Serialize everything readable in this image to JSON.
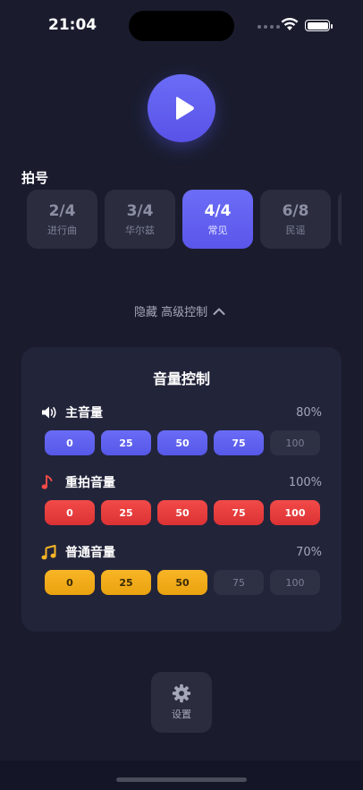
{
  "status": {
    "time": "21:04"
  },
  "time_signature": {
    "label": "拍号",
    "items": [
      {
        "value": "2/4",
        "name": "进行曲",
        "active": false
      },
      {
        "value": "3/4",
        "name": "华尔兹",
        "active": false
      },
      {
        "value": "4/4",
        "name": "常见",
        "active": true
      },
      {
        "value": "6/8",
        "name": "民谣",
        "active": false
      }
    ]
  },
  "advanced": {
    "label": "隐藏 高级控制"
  },
  "volume": {
    "title": "音量控制",
    "groups": [
      {
        "name": "主音量",
        "percent": "80%",
        "theme": "blue",
        "icon": "speaker-icon",
        "steps": [
          "0",
          "25",
          "50",
          "75",
          "100"
        ],
        "active_count": 4
      },
      {
        "name": "重拍音量",
        "percent": "100%",
        "theme": "red",
        "icon": "music-note-icon",
        "steps": [
          "0",
          "25",
          "50",
          "75",
          "100"
        ],
        "active_count": 5
      },
      {
        "name": "普通音量",
        "percent": "70%",
        "theme": "yellow",
        "icon": "music-notes-icon",
        "steps": [
          "0",
          "25",
          "50",
          "75",
          "100"
        ],
        "active_count": 3
      }
    ]
  },
  "settings": {
    "label": "设置"
  },
  "colors": {
    "background": "#1a1c2e",
    "accent": "#5b56ea",
    "strong": "#dc3234",
    "normal": "#eaa20f"
  }
}
